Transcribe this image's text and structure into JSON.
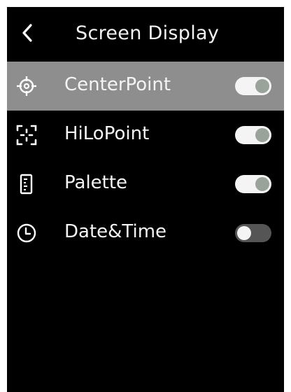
{
  "header": {
    "back_icon": "chevron-left-icon",
    "title": "Screen Display"
  },
  "settings": [
    {
      "label": "CenterPoint",
      "icon": "crosshair-icon",
      "enabled": true,
      "selected": true
    },
    {
      "label": "HiLoPoint",
      "icon": "focus-frame-icon",
      "enabled": true,
      "selected": false
    },
    {
      "label": "Palette",
      "icon": "palette-scale-icon",
      "enabled": true,
      "selected": false
    },
    {
      "label": "Date&Time",
      "icon": "clock-icon",
      "enabled": false,
      "selected": false
    }
  ],
  "colors": {
    "background": "#000000",
    "selected_row": "#8e8e8e",
    "text": "#f4f4f4",
    "toggle_on_track": "#f4f4f4",
    "toggle_on_knob": "#9aa39a",
    "toggle_off_track": "#555555",
    "toggle_off_knob": "#f4f4f4"
  }
}
